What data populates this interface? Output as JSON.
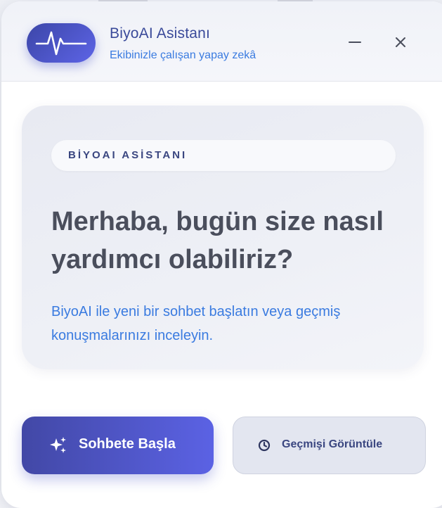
{
  "header": {
    "title": "BiyoAI Asistanı",
    "subtitle": "Ekibinizle çalışan yapay zekâ",
    "logo_icon": "heartbeat-pulse-icon",
    "minimize_icon": "minimize-icon",
    "close_icon": "close-icon"
  },
  "welcome": {
    "badge": "BİYOAI ASİSTANI",
    "headline": "Merhaba, bugün size nasıl yardımcı olabiliriz?",
    "description": "BiyoAI ile yeni bir sohbet başlatın veya geçmiş konuşmalarınızı inceleyin."
  },
  "actions": {
    "start_label": "Sohbete Başla",
    "start_icon": "sparkles-icon",
    "history_label": "Geçmişi Görüntüle",
    "history_icon": "clock-icon"
  },
  "colors": {
    "accent": "#4a52c8",
    "accent_light": "#5d64e6",
    "link_blue": "#3a7be0",
    "headline": "#4a4e5c"
  }
}
